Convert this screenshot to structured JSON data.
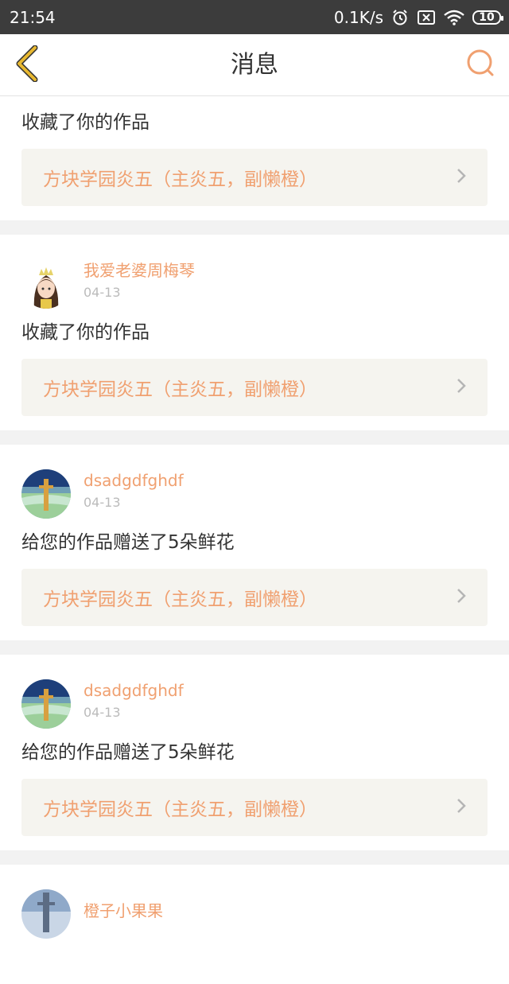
{
  "status_bar": {
    "time": "21:54",
    "speed": "0.1K/s",
    "battery": "10",
    "icons": [
      "alarm-icon",
      "sim-off-icon",
      "wifi-icon",
      "battery-icon"
    ]
  },
  "header": {
    "title": "消息",
    "back_icon": "chevron-left-icon",
    "search_icon": "search-icon"
  },
  "colors": {
    "accent": "#f0a070",
    "back_icon": "#e8b830",
    "text": "#333333",
    "date": "#bbbbbb",
    "link_bg": "#f5f4ef"
  },
  "messages": [
    {
      "action": "收藏了你的作品",
      "work_title": "方块学园炎五（主炎五，副懒橙）"
    },
    {
      "username": "我爱老婆周梅琴",
      "date": "04-13",
      "action": "收藏了你的作品",
      "work_title": "方块学园炎五（主炎五，副懒橙）"
    },
    {
      "username": "dsadgdfghdf",
      "date": "04-13",
      "action": "给您的作品赠送了5朵鲜花",
      "work_title": "方块学园炎五（主炎五，副懒橙）"
    },
    {
      "username": "dsadgdfghdf",
      "date": "04-13",
      "action": "给您的作品赠送了5朵鲜花",
      "work_title": "方块学园炎五（主炎五，副懒橙）"
    },
    {
      "username": "橙子小果果"
    }
  ]
}
